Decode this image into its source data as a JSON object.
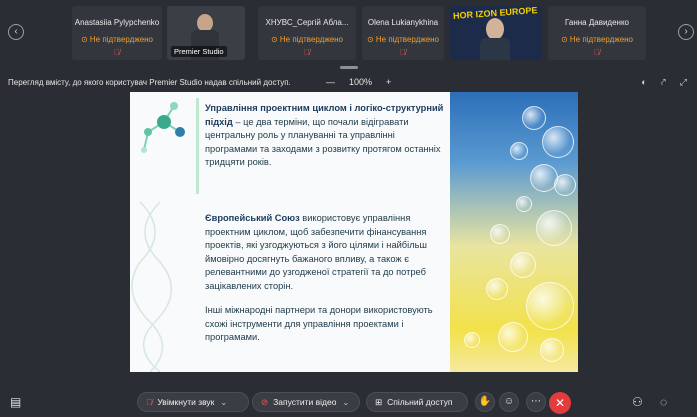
{
  "participants": [
    {
      "name": "Anastasiia Pylypchenko",
      "status": "Не підтверджено"
    },
    {
      "name": "Premier Studio",
      "video": true
    },
    {
      "name": "ХНУВС_Сергій Абла...",
      "status": "Не підтверджено"
    },
    {
      "name": "Olena Lukianykhina",
      "status": "Не підтверджено"
    },
    {
      "name": "",
      "video": true,
      "banner": "HOR IZON EUROPE"
    },
    {
      "name": "Ганна Давиденко",
      "status": "Не підтверджено"
    }
  ],
  "sharebar": {
    "info": "Перегляд вмісту, до якого користувач Premier Studio надав спільний доступ.",
    "zoom_out": "—",
    "zoom_level": "100%",
    "zoom_in": "+"
  },
  "slide": {
    "p1_bold": "Управління проектним циклом і логіко-структурний підхід",
    "p1_rest": " – це два терміни, що почали відігравати центральну роль у плануванні та управлінні програмами та заходами з розвитку протягом останніх тридцяти років.",
    "p2_bold": "Європейський Союз",
    "p2_rest": " використовує управління проектним циклом, щоб забезпечити фінансування проектів, які узгоджуються з його цілями і найбільш ймовірно досягнуть бажаного впливу, а також є релевантними до узгодженої стратегії та до потреб зацікавлених сторін.",
    "p3": "Інші міжнародні партнери та донори використовують схожі інструменти для управління проектами і програмами."
  },
  "controls": {
    "unmute": "Увімкнути звук",
    "start_video": "Запустити відео",
    "share": "Спільний доступ"
  },
  "colors": {
    "background": "#2a2d33",
    "status_warning": "#f0a030",
    "end_call": "#e23c3c"
  }
}
